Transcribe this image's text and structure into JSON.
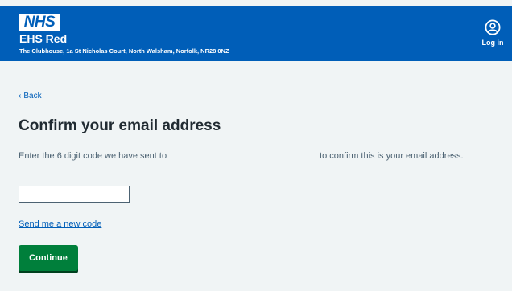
{
  "header": {
    "logo_text": "NHS",
    "organisation_name": "EHS Red",
    "organisation_address": "The Clubhouse, 1a St Nicholas Court, North Walsham, Norfolk, NR28 0NZ",
    "login_label": "Log in",
    "login_icon": "user-circle-icon",
    "background_color": "#005eb8"
  },
  "main": {
    "back_label": "Back",
    "title": "Confirm your email address",
    "instruction_part1": "Enter the 6 digit code we have sent to",
    "instruction_part2": "to confirm this is your email address.",
    "code_input_value": "",
    "resend_link": "Send me a new code",
    "continue_label": "Continue"
  },
  "colors": {
    "link": "#005eb8",
    "primary_button": "#007f3b",
    "page_background": "#f0f4f5",
    "text": "#212b32",
    "secondary_text": "#4c6272"
  }
}
